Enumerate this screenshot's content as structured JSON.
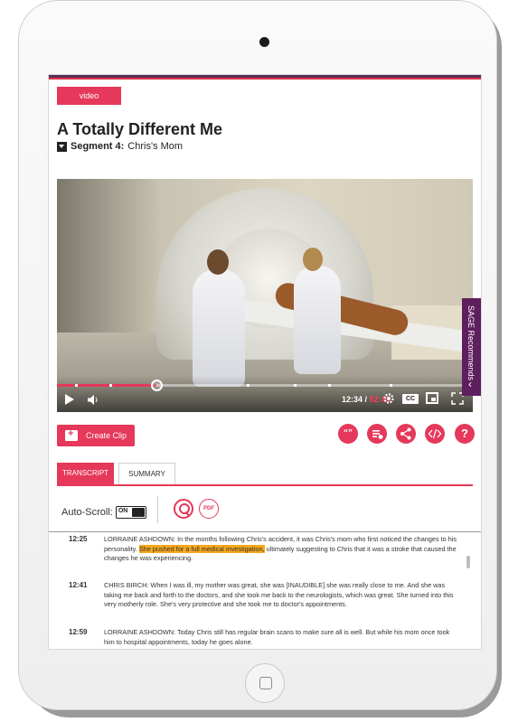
{
  "header": {
    "content_type": "video",
    "title": "A Totally Different Me",
    "segment_label": "Segment 4:",
    "segment_name": "Chris's Mom"
  },
  "player": {
    "current_time": "12:34",
    "separator": " / ",
    "duration": "52:45",
    "progress": 0.24,
    "cc_label": "CC"
  },
  "sidebar": {
    "sage_recommends": "SAGE Recommends"
  },
  "actions": {
    "create_clip": "Create Clip",
    "cite_label": "“”",
    "help_label": "?"
  },
  "tabs": [
    {
      "label": "TRANSCRIPT",
      "active": true
    },
    {
      "label": "SUMMARY",
      "active": false
    }
  ],
  "controls": {
    "auto_scroll_label": "Auto-Scroll:",
    "toggle_state": "ON",
    "pdf_label": "PDF"
  },
  "transcript": [
    {
      "time": "12:25",
      "before": "LORRAINE ASHDOWN: In the months following Chris's accident, it was Chris's mom who first noticed the changes to his personality. ",
      "highlight": "She pushed for a full medical investigation,",
      "after": " ultimately suggesting to Chris that it was a stroke that caused the changes he was experiencing."
    },
    {
      "time": "12:41",
      "before": "CHRIS BIRCH: When I was ill, my mother was great, she was [INAUDIBLE] she was really close to me. And she was taking me back and forth to the doctors, and she took me back to the neurologists, which was great. She turned into this very motherly role. She's very protective and she took me to doctor's appointments.",
      "highlight": "",
      "after": ""
    },
    {
      "time": "12:59",
      "before": "LORRAINE ASHDOWN: Today Chris still has regular brain scans to make sure all is well. But while his mom once took him to hospital appointments, today he goes alone.",
      "highlight": "",
      "after": ""
    }
  ],
  "colors": {
    "accent": "#e5385a",
    "brand_purple": "#5e1f5e",
    "highlight": "#f7a81b"
  }
}
